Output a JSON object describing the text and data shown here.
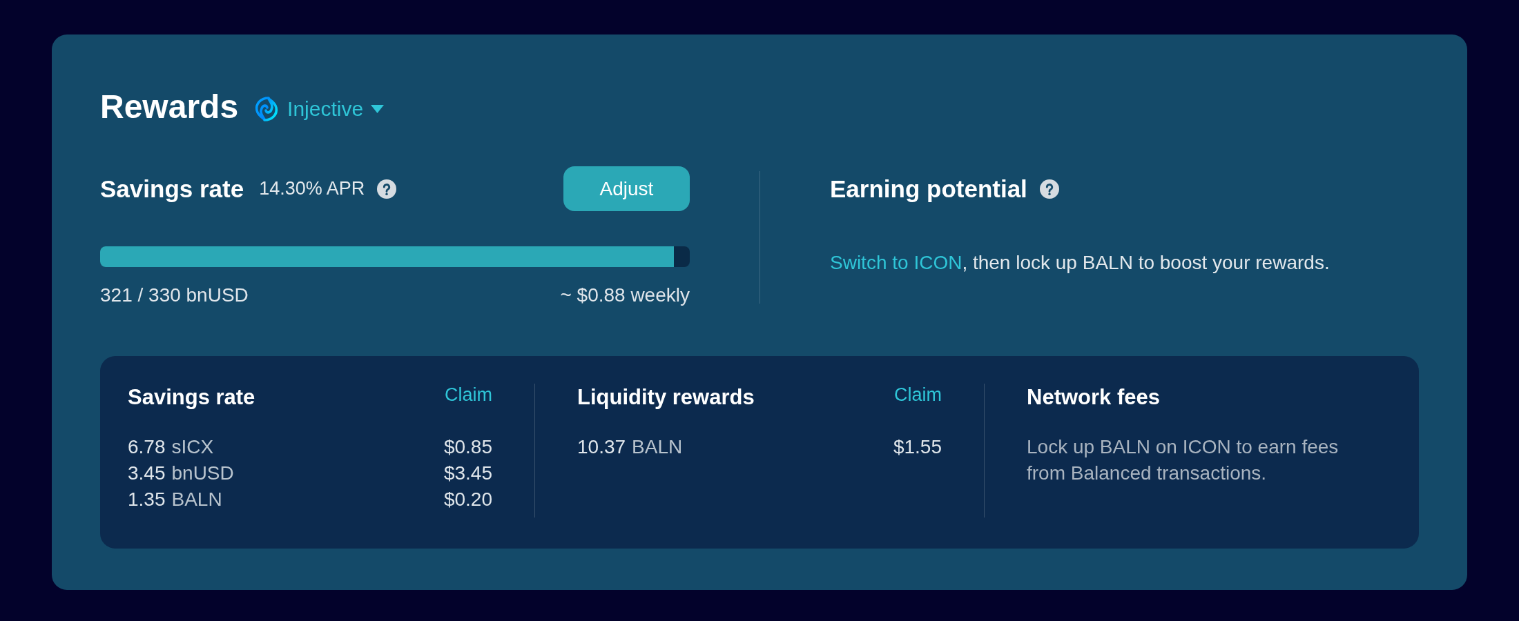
{
  "header": {
    "title": "Rewards",
    "network": {
      "name": "Injective"
    }
  },
  "savings": {
    "title": "Savings rate",
    "apr": "14.30% APR",
    "adjust_button": "Adjust",
    "progress": {
      "level": 0.973
    },
    "deposit": "321 / 330 bnUSD",
    "weekly": "~ $0.88 weekly"
  },
  "earning_potential": {
    "title": "Earning potential",
    "message": {
      "link": "Switch to ICON",
      "text": ", then lock up BALN to boost your rewards."
    }
  },
  "reward_sections": [
    {
      "kind": "claimable",
      "title": "Savings rate",
      "claim": "Claim",
      "rows": [
        {
          "amount": "6.78",
          "symbol": "sICX",
          "value": "$0.85"
        },
        {
          "amount": "3.45",
          "symbol": "bnUSD",
          "value": "$3.45"
        },
        {
          "amount": "1.35",
          "symbol": "BALN",
          "value": "$0.20"
        }
      ]
    },
    {
      "kind": "claimable",
      "title": "Liquidity rewards",
      "claim": "Claim",
      "rows": [
        {
          "amount": "10.37",
          "symbol": "BALN",
          "value": "$1.55"
        }
      ]
    },
    {
      "kind": "info",
      "title": "Network fees",
      "description": "Lock up BALN on ICON to earn fees from Balanced transactions."
    }
  ]
}
